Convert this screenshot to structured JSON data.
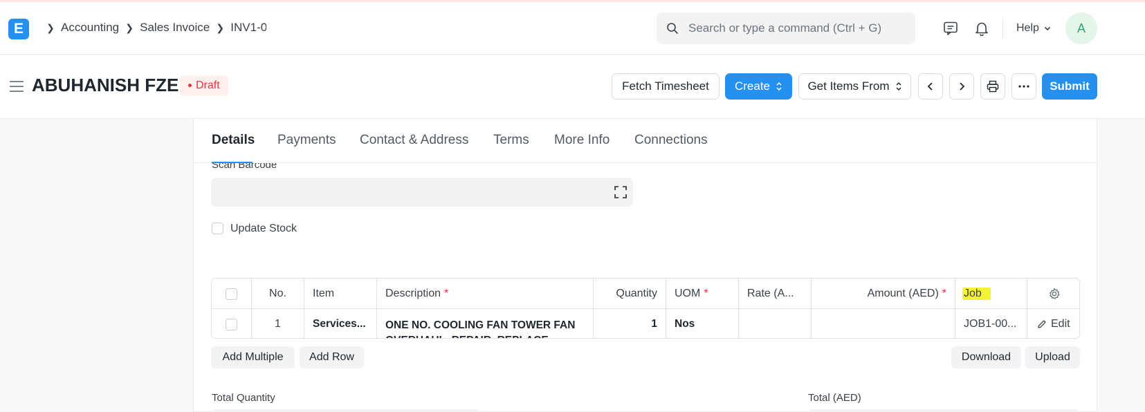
{
  "app": {
    "logo_letter": "E"
  },
  "breadcrumbs": [
    "Accounting",
    "Sales Invoice",
    "INV1-0"
  ],
  "search": {
    "placeholder": "Search or type a command (Ctrl + G)"
  },
  "nav": {
    "help_label": "Help",
    "avatar_initial": "A"
  },
  "page": {
    "title": "ABUHANISH FZE",
    "status": "Draft"
  },
  "actions": {
    "fetch_timesheet": "Fetch Timesheet",
    "create": "Create",
    "get_items_from": "Get Items From",
    "submit": "Submit"
  },
  "tabs": [
    "Details",
    "Payments",
    "Contact & Address",
    "Terms",
    "More Info",
    "Connections"
  ],
  "form": {
    "scan_barcode_label": "Scan Barcode",
    "update_stock_label": "Update Stock"
  },
  "items_table": {
    "columns": {
      "no": "No.",
      "item": "Item",
      "description": "Description",
      "quantity": "Quantity",
      "uom": "UOM",
      "rate": "Rate (A...",
      "amount": "Amount (AED)",
      "job": "Job"
    },
    "rows": [
      {
        "no": "1",
        "item": "Services...",
        "description": "ONE NO. COOLING FAN TOWER FAN",
        "description_line2": "OVERHAUL, REPAIR, REPLACE",
        "quantity": "1",
        "uom": "Nos",
        "rate": "",
        "amount": "",
        "job": "JOB1-00...",
        "edit_label": "Edit"
      }
    ],
    "buttons": {
      "add_multiple": "Add Multiple",
      "add_row": "Add Row",
      "download": "Download",
      "upload": "Upload"
    }
  },
  "totals": {
    "total_quantity_label": "Total Quantity",
    "total_label": "Total (AED)"
  },
  "colors": {
    "primary": "#2490ef",
    "draft": "#e03636",
    "highlight": "#f5f336",
    "avatar_bg": "#e4f5e9",
    "avatar_fg": "#30a66d"
  }
}
